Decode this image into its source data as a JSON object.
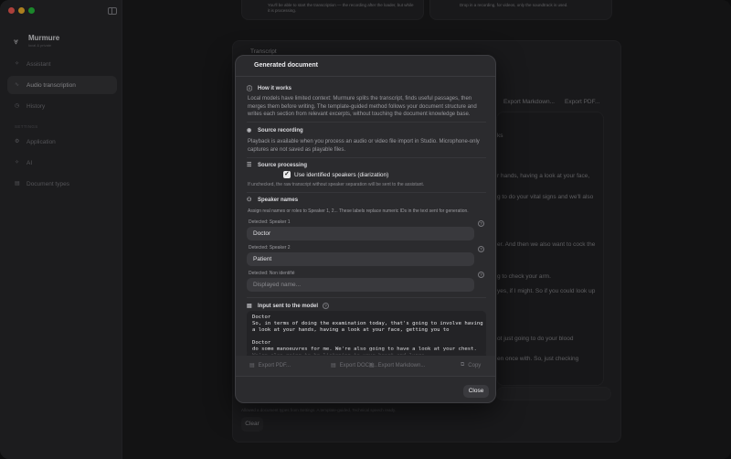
{
  "app": {
    "name": "Murmure",
    "subtitle": "local & private"
  },
  "sidebar": {
    "items": [
      {
        "label": "Assistant",
        "icon": "sparkle-icon"
      },
      {
        "label": "Audio transcription",
        "icon": "waveform-icon"
      },
      {
        "label": "History",
        "icon": "clock-icon"
      }
    ],
    "settings_label": "SETTINGS",
    "settings_items": [
      {
        "label": "Application",
        "icon": "gear-icon"
      },
      {
        "label": "AI",
        "icon": "sparkle-icon"
      },
      {
        "label": "Document types",
        "icon": "file-icon"
      }
    ]
  },
  "background": {
    "top_card_left": "You'll be able to start the transcription — the recording after the loader, but while it is processing.",
    "top_card_right": "Drop in a recording, for videos, only the soundtrack is used.",
    "transcript_label": "Transcript",
    "export_markdown": "Export Markdown...",
    "export_pdf": "Export PDF...",
    "snippets": [
      "ks",
      "r hands, having a look at your face,",
      "g to do your vital signs and we'll also",
      "er. And then we also want to cock the",
      "g to check your arm.",
      "yes, if I might. So if you could look up",
      "ot just going to do your blood",
      "en once with. So, just checking"
    ],
    "footer_hint": "Allowed a document types from Settings. A template-guided, Technical speech ready.",
    "clear_label": "Clear"
  },
  "modal": {
    "title": "Generated document",
    "how_title": "How it works",
    "how_text": "Local models have limited context: Murmure splits the transcript, finds useful passages, then merges them before writing. The template-guided method follows your document structure and writes each section from relevant excerpts, without touching the document knowledge base.",
    "source_title": "Source recording",
    "source_text": "Playback is available when you process an audio or video file import in Studio. Microphone-only captures are not saved as playable files.",
    "processing_title": "Source processing",
    "checkbox_label": "Use identified speakers (diarization)",
    "checkbox_hint": "If unchecked, the raw transcript without speaker separation will be sent to the assistant.",
    "speakers_title": "Speaker names",
    "speakers_text": "Assign real names or roles to Speaker 1, 2... These labels replace numeric IDs in the text sent for generation.",
    "speakers": [
      {
        "detected": "Detected: Speaker 1",
        "value": "Doctor"
      },
      {
        "detected": "Detected: Speaker 2",
        "value": "Patient"
      }
    ],
    "unidentified_label": "Detected: Non identifié",
    "unidentified_placeholder": "Displayed name...",
    "input_title": "Input sent to the model",
    "input_text": "Doctor\nSo, in terms of doing the examination today, that's going to involve having\na look at your hands, having a look at your face, getting you to\n\nDoctor\ndo some manoeuvres for me. We're also going to have a look at your chest.\nWe're also going to be listening to your heart and lungs.",
    "export_pdf": "Export PDF...",
    "export_docx": "Export DOCX...",
    "export_markdown": "Export Markdown...",
    "copy": "Copy",
    "close": "Close"
  }
}
